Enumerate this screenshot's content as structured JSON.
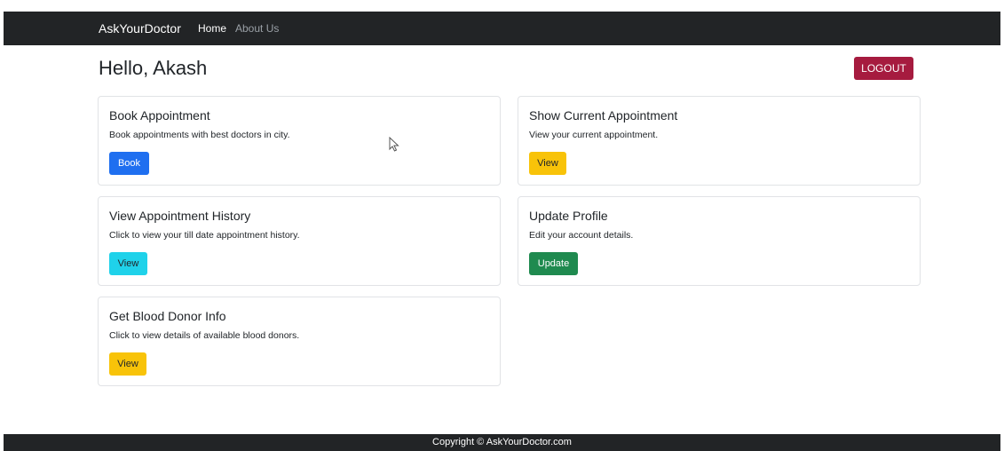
{
  "navbar": {
    "brand": "AskYourDoctor",
    "links": [
      {
        "label": "Home",
        "active": true
      },
      {
        "label": "About Us",
        "active": false
      }
    ]
  },
  "header": {
    "greeting": "Hello, Akash",
    "logout_label": "LOGOUT"
  },
  "cards": [
    {
      "title": "Book Appointment",
      "text": "Book appointments with best doctors in city.",
      "button_label": "Book",
      "button_color": "#1f6ff0"
    },
    {
      "title": "Show Current Appointment",
      "text": "View your current appointment.",
      "button_label": "View",
      "button_color": "#f8c309"
    },
    {
      "title": "View Appointment History",
      "text": "Click to view your till date appointment history.",
      "button_label": "View",
      "button_color": "#1fd2ea"
    },
    {
      "title": "Update Profile",
      "text": "Edit your account details.",
      "button_label": "Update",
      "button_color": "#1f8a4f"
    },
    {
      "title": "Get Blood Donor Info",
      "text": "Click to view details of available blood donors.",
      "button_label": "View",
      "button_color": "#f8c309"
    }
  ],
  "footer": {
    "text": "Copyright © AskYourDoctor.com"
  },
  "colors": {
    "navbar_bg": "#222426",
    "logout": "#a61b3f"
  },
  "icons": {
    "cursor": "mouse-pointer-icon"
  }
}
